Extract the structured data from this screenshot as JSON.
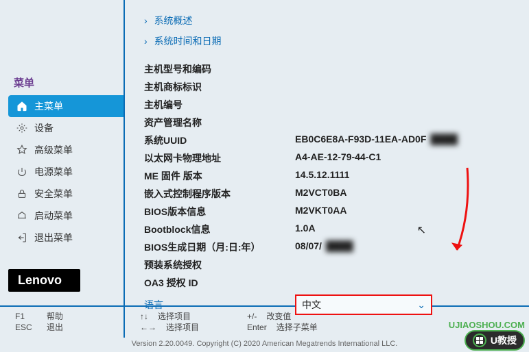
{
  "sidebar": {
    "title": "菜单",
    "items": [
      {
        "label": "主菜单"
      },
      {
        "label": "设备"
      },
      {
        "label": "高级菜单"
      },
      {
        "label": "电源菜单"
      },
      {
        "label": "安全菜单"
      },
      {
        "label": "启动菜单"
      },
      {
        "label": "退出菜单"
      }
    ]
  },
  "logo": "Lenovo",
  "links": {
    "overview": "系统概述",
    "datetime": "系统时间和日期"
  },
  "info": [
    {
      "label": "主机型号和编码",
      "value": " ",
      "blur": true
    },
    {
      "label": "主机商标标识",
      "value": " ",
      "blur": true
    },
    {
      "label": "主机编号",
      "value": " ",
      "blur": true
    },
    {
      "label": "资产管理名称",
      "value": ""
    },
    {
      "label": "系统UUID",
      "value": "EB0C6E8A-F93D-11EA-AD0F",
      "blurTail": true
    },
    {
      "label": "以太网卡物理地址",
      "value": "A4-AE-12-79-44-C1"
    },
    {
      "label": "ME 固件 版本",
      "value": "14.5.12.1111"
    },
    {
      "label": "嵌入式控制程序版本",
      "value": "M2VCT0BA"
    },
    {
      "label": "BIOS版本信息",
      "value": "M2VKT0AA"
    },
    {
      "label": "Bootblock信息",
      "value": "1.0A"
    },
    {
      "label": "BIOS生成日期（月:日:年）",
      "value": "08/07/",
      "blurTail": true
    },
    {
      "label": "预装系统授权",
      "value": " ",
      "blur": true
    },
    {
      "label": "OA3 授权 ID",
      "value": " ",
      "blur": true
    }
  ],
  "language": {
    "label": "语言",
    "value": "中文"
  },
  "footer": {
    "left": [
      {
        "key": "F1",
        "label": "帮助"
      },
      {
        "key": "ESC",
        "label": "退出"
      }
    ],
    "mid1": [
      {
        "key": "↑↓",
        "label": "选择项目"
      },
      {
        "key": "←→",
        "label": "选择项目"
      }
    ],
    "mid2": [
      {
        "key": "+/-",
        "label": "改变值"
      },
      {
        "key": "Enter",
        "label": "选择子菜单"
      }
    ]
  },
  "copyright": "Version 2.20.0049. Copyright (C) 2020 American Megatrends International LLC.",
  "watermark": {
    "site": "UJIAOSHOU.COM",
    "badge": "U教授"
  }
}
